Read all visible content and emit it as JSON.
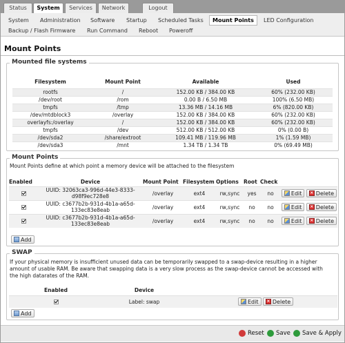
{
  "top_tabs": [
    "Status",
    "System",
    "Services",
    "Network",
    "Logout"
  ],
  "sub_tabs": {
    "row1": [
      "System",
      "Administration",
      "Software",
      "Startup",
      "Scheduled Tasks",
      "Mount Points",
      "LED Configuration"
    ],
    "row2": [
      "Backup / Flash Firmware",
      "Run Command",
      "Reboot",
      "Poweroff"
    ]
  },
  "page_title": "Mount Points",
  "mounted": {
    "legend": "Mounted file systems",
    "headers": [
      "Filesystem",
      "Mount Point",
      "Available",
      "Used"
    ],
    "rows": [
      [
        "rootfs",
        "/",
        "152.00 KB / 384.00 KB",
        "60% (232.00 KB)"
      ],
      [
        "/dev/root",
        "/rom",
        "0.00 B / 6.50 MB",
        "100% (6.50 MB)"
      ],
      [
        "tmpfs",
        "/tmp",
        "13.36 MB / 14.16 MB",
        "6% (820.00 KB)"
      ],
      [
        "/dev/mtdblock3",
        "/overlay",
        "152.00 KB / 384.00 KB",
        "60% (232.00 KB)"
      ],
      [
        "overlayfs:/overlay",
        "/",
        "152.00 KB / 384.00 KB",
        "60% (232.00 KB)"
      ],
      [
        "tmpfs",
        "/dev",
        "512.00 KB / 512.00 KB",
        "0% (0.00 B)"
      ],
      [
        "/dev/sda2",
        "/share/extroot",
        "109.41 MB / 119.96 MB",
        "1% (1.59 MB)"
      ],
      [
        "/dev/sda3",
        "/mnt",
        "1.34 TB / 1.34 TB",
        "0% (69.49 MB)"
      ]
    ]
  },
  "mount_points": {
    "legend": "Mount Points",
    "description": "Mount Points define at which point a memory device will be attached to the filesystem",
    "headers": [
      "Enabled",
      "Device",
      "Mount Point",
      "Filesystem",
      "Options",
      "Root",
      "Check"
    ],
    "rows": [
      {
        "device_l1": "UUID: 32063ca3-996d-44e3-8333-",
        "device_l2": "d98f9ec728e8",
        "mount": "/overlay",
        "fs": "ext4",
        "options": "rw,sync",
        "root": "yes",
        "check": "no"
      },
      {
        "device_l1": "UUID: c3677b2b-931d-4b1a-a65d-",
        "device_l2": "133ec83e8eab",
        "mount": "/overlay",
        "fs": "ext4",
        "options": "rw,sync",
        "root": "no",
        "check": "no"
      },
      {
        "device_l1": "UUID: c3677b2b-931d-4b1a-a65d-",
        "device_l2": "133ec83e8eab",
        "mount": "/overlay",
        "fs": "ext4",
        "options": "rw,sync",
        "root": "no",
        "check": "no"
      }
    ],
    "edit_label": "Edit",
    "delete_label": "Delete",
    "add_label": "Add"
  },
  "swap": {
    "legend": "SWAP",
    "description_l1": "If your physical memory is insufficient unused data can be temporarily swapped to a swap-device resulting in a higher",
    "description_l2": "amount of usable RAM. Be aware that swapping data is a very slow process as the swap-device cannot be accessed with",
    "description_l3": "the high datarates of the RAM.",
    "headers": [
      "Enabled",
      "Device"
    ],
    "row": {
      "device": "Label: swap"
    },
    "edit_label": "Edit",
    "delete_label": "Delete",
    "add_label": "Add"
  },
  "footer": {
    "reset": "Reset",
    "save": "Save",
    "save_apply": "Save & Apply"
  },
  "colors": {
    "reset": "#d13a3a",
    "save": "#2e9b3c",
    "save_apply": "#2e9b3c"
  }
}
